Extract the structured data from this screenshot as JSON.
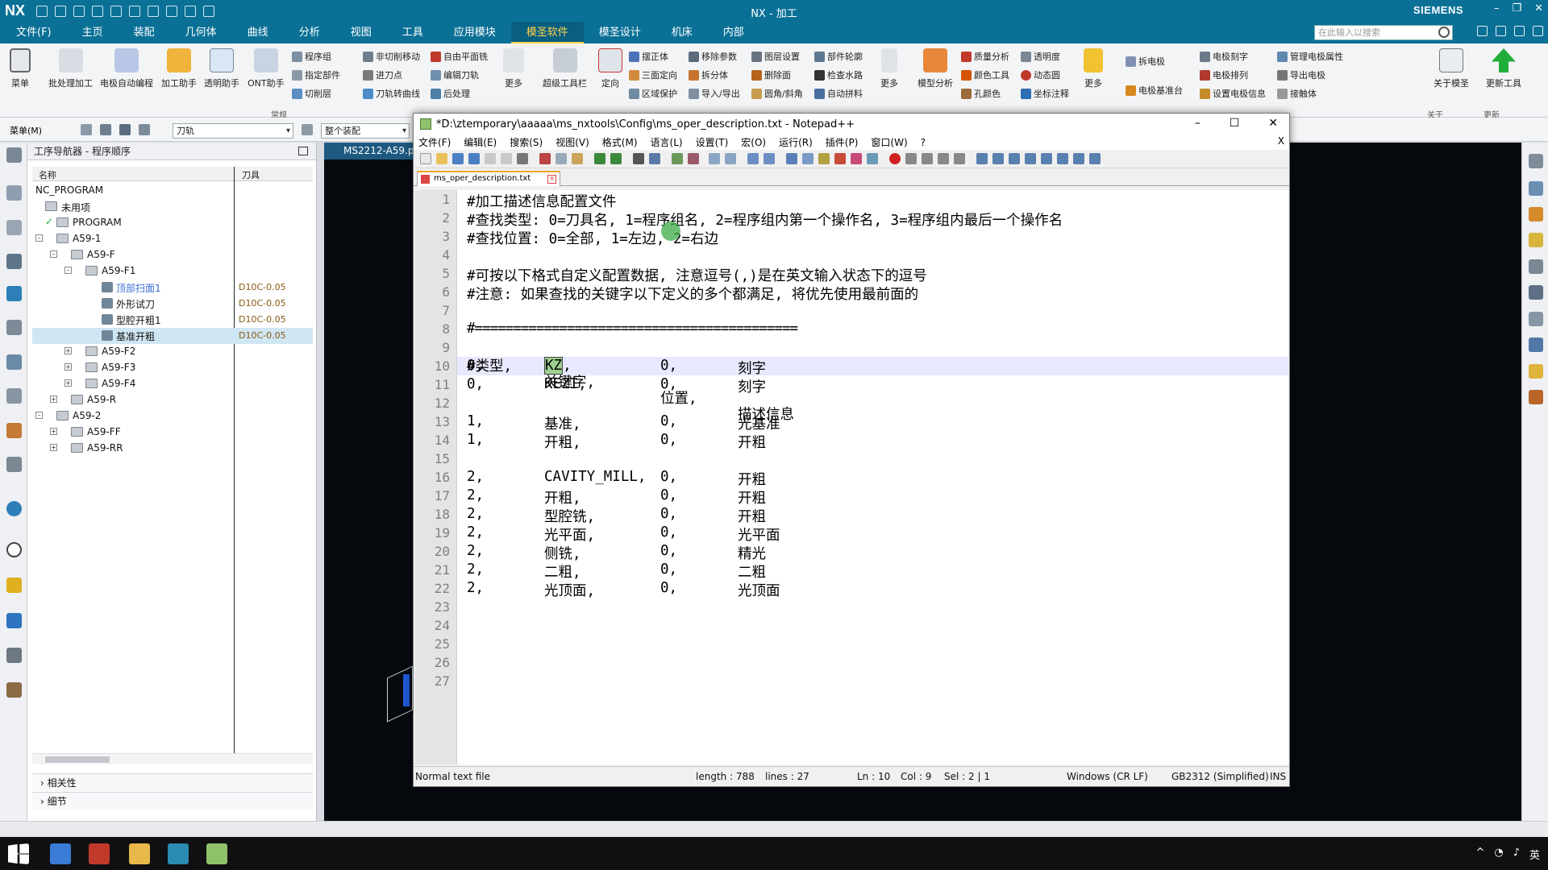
{
  "nx": {
    "logo": "NX",
    "app_title": "NX - 加工",
    "brand": "SIEMENS",
    "menu": [
      "文件(F)",
      "主页",
      "装配",
      "几何体",
      "曲线",
      "分析",
      "视图",
      "工具",
      "应用模块",
      "模圣软件",
      "模圣设计",
      "机床",
      "内部"
    ],
    "active_menu": "模圣软件",
    "search_placeholder": "在此输入以搜索",
    "window_controls": [
      "–",
      "❐",
      "✕"
    ]
  },
  "ribbon": {
    "big": [
      "菜单",
      "批处理加工",
      "电极自动编程",
      "加工助手",
      "透明助手",
      "ONT助手",
      "更多",
      "超级工具栏",
      "定向",
      "更多",
      "模型分析",
      "更多",
      "关于模圣",
      "更新工具"
    ],
    "small": [
      "程序组",
      "指定部件",
      "切削层",
      "非切削移动",
      "进刀点",
      "刀轨转曲线",
      "自由平面铣",
      "编辑刀轨",
      "后处理",
      "摆正体",
      "三面定向",
      "区域保护",
      "移除参数",
      "拆分体",
      "导入/导出",
      "图层设置",
      "删除面",
      "圆角/斜角",
      "部件轮廓",
      "检查水路",
      "自动拼料",
      "质量分析",
      "颜色工具",
      "孔颜色",
      "透明度",
      "动态圆",
      "坐标注释",
      "拆电极",
      "电极基准台",
      "电极刻字",
      "电极排列",
      "设置电极信息",
      "管理电极属性",
      "导出电极",
      "接触体"
    ],
    "group_label": "常规",
    "tab_labels": [
      "关于",
      "更新"
    ]
  },
  "toolbar2": {
    "menu_label": "菜单(M)",
    "filter_value": "刀轨",
    "assembly_value": "整个装配"
  },
  "navigator": {
    "title": "工序导航器 - 程序顺序",
    "columns": [
      "名称",
      "刀具"
    ],
    "rows": [
      {
        "label": "NC_PROGRAM",
        "tool": ""
      },
      {
        "label": "未用项",
        "tool": ""
      },
      {
        "label": "PROGRAM",
        "tool": ""
      },
      {
        "label": "A59-1",
        "tool": ""
      },
      {
        "label": "A59-F",
        "tool": ""
      },
      {
        "label": "A59-F1",
        "tool": ""
      },
      {
        "label": "顶部扫面1",
        "tool": "D10C-0.05"
      },
      {
        "label": "外形试刀",
        "tool": "D10C-0.05"
      },
      {
        "label": "型腔开粗1",
        "tool": "D10C-0.05"
      },
      {
        "label": "基准开粗",
        "tool": "D10C-0.05"
      },
      {
        "label": "A59-F2",
        "tool": ""
      },
      {
        "label": "A59-F3",
        "tool": ""
      },
      {
        "label": "A59-F4",
        "tool": ""
      },
      {
        "label": "A59-R",
        "tool": ""
      },
      {
        "label": "A59-2",
        "tool": ""
      },
      {
        "label": "A59-FF",
        "tool": ""
      },
      {
        "label": "A59-RR",
        "tool": ""
      }
    ],
    "sections": [
      "相关性",
      "细节"
    ]
  },
  "graphics_tab": "MS2212-A59.p",
  "notepad": {
    "title": "*D:\\ztemporary\\aaaaa\\ms_nxtools\\Config\\ms_oper_description.txt - Notepad++",
    "menu": [
      "文件(F)",
      "编辑(E)",
      "搜索(S)",
      "视图(V)",
      "格式(M)",
      "语言(L)",
      "设置(T)",
      "宏(O)",
      "运行(R)",
      "插件(P)",
      "窗口(W)",
      "?"
    ],
    "close_doc": "X",
    "tab": "ms_oper_description.txt",
    "line_numbers": [
      "1",
      "2",
      "3",
      "4",
      "5",
      "6",
      "7",
      "8",
      "9",
      "10",
      "11",
      "12",
      "13",
      "14",
      "15",
      "16",
      "17",
      "18",
      "19",
      "20",
      "21",
      "22",
      "23",
      "24",
      "25",
      "26",
      "27"
    ],
    "lines": {
      "l1": "#加工描述信息配置文件",
      "l2": "#查找类型: 0=刀具名, 1=程序组名, 2=程序组内第一个操作名, 3=程序组内最后一个操作名",
      "l3": "#查找位置: 0=全部, 1=左边, 2=右边",
      "l5": "#可按以下格式自定义配置数据, 注意逗号(,)是在英文输入状态下的逗号",
      "l6": "#注意: 如果查找的关键字以下定义的多个都满足, 将优先使用最前面的",
      "l8": "#==========================================",
      "l9": [
        "#类型,",
        "关键字,",
        "位置,",
        "描述信息"
      ]
    },
    "rows": [
      {
        "line": 10,
        "type": "0,",
        "key": "KZ",
        "comma": ",",
        "pos": "0,",
        "desc": "刻字"
      },
      {
        "line": 11,
        "type": "0,",
        "key": "KEZI,",
        "pos": "0,",
        "desc": "刻字"
      },
      {
        "line": 13,
        "type": "1,",
        "key": "基准,",
        "pos": "0,",
        "desc": "光基准"
      },
      {
        "line": 14,
        "type": "1,",
        "key": "开粗,",
        "pos": "0,",
        "desc": "开粗"
      },
      {
        "line": 16,
        "type": "2,",
        "key": "CAVITY_MILL,",
        "pos": "0,",
        "desc": "开粗"
      },
      {
        "line": 17,
        "type": "2,",
        "key": "开粗,",
        "pos": "0,",
        "desc": "开粗"
      },
      {
        "line": 18,
        "type": "2,",
        "key": "型腔铣,",
        "pos": "0,",
        "desc": "开粗"
      },
      {
        "line": 19,
        "type": "2,",
        "key": "光平面,",
        "pos": "0,",
        "desc": "光平面"
      },
      {
        "line": 20,
        "type": "2,",
        "key": "侧铣,",
        "pos": "0,",
        "desc": "精光"
      },
      {
        "line": 21,
        "type": "2,",
        "key": "二粗,",
        "pos": "0,",
        "desc": "二粗"
      },
      {
        "line": 22,
        "type": "2,",
        "key": "光顶面,",
        "pos": "0,",
        "desc": "光顶面"
      }
    ],
    "status": {
      "type": "Normal text file",
      "length": "length : 788",
      "lines": "lines : 27",
      "ln": "Ln : 10",
      "col": "Col : 9",
      "sel": "Sel : 2 | 1",
      "eol": "Windows (CR LF)",
      "encoding": "GB2312 (Simplified)",
      "mode": "INS"
    }
  },
  "taskbar": {
    "tray": [
      "^",
      "英"
    ]
  },
  "colors": {
    "nx_bar": "#0a7096",
    "active_menu": "#ffd24d",
    "selection": "#9ed08f",
    "current_line": "#e8e8ff"
  }
}
